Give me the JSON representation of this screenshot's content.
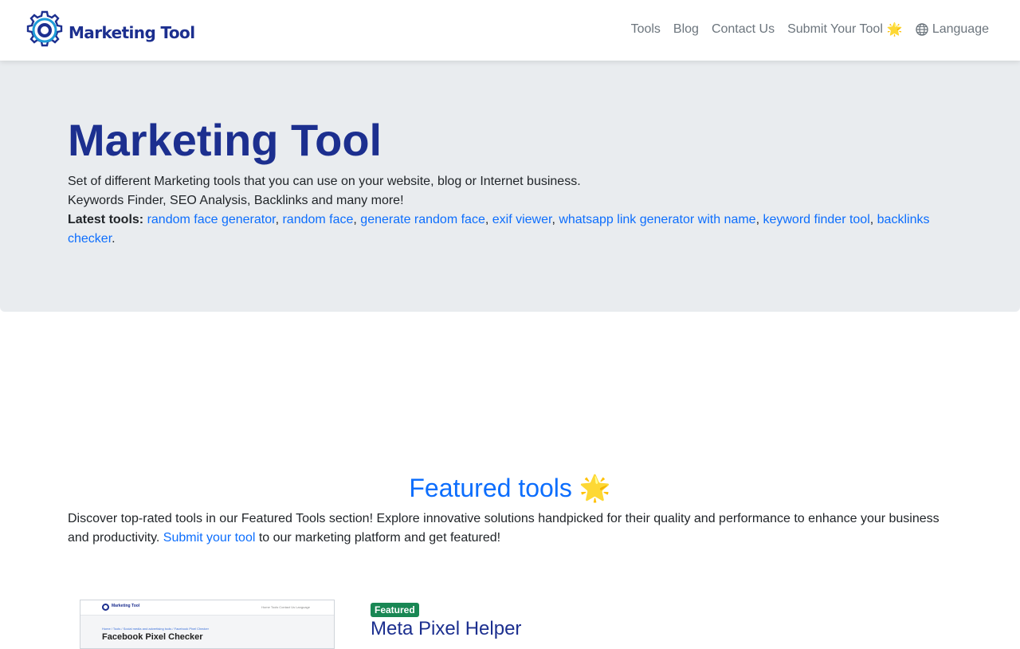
{
  "navbar": {
    "brand": "Marketing Tool",
    "links": [
      {
        "label": "Tools"
      },
      {
        "label": "Blog"
      },
      {
        "label": "Contact Us"
      },
      {
        "label": "Submit Your Tool",
        "icon": "star-icon"
      },
      {
        "label": "Language",
        "icon": "globe-icon"
      }
    ]
  },
  "hero": {
    "title": "Marketing Tool",
    "line1": "Set of different Marketing tools that you can use on your website, blog or Internet business.",
    "line2": "Keywords Finder, SEO Analysis, Backlinks and many more!",
    "latest_label": "Latest tools:",
    "latest_tools": [
      "random face generator",
      "random face",
      "generate random face",
      "exif viewer",
      "whatsapp link generator with name",
      "keyword finder tool",
      "backlinks checker"
    ]
  },
  "featured": {
    "title": "Featured tools",
    "title_icon": "🌟",
    "intro_before": "Discover top-rated tools in our Featured Tools section! Explore innovative solutions handpicked for their quality and performance to enhance your business and productivity.",
    "intro_link": "Submit your tool",
    "intro_after": "to our marketing platform and get featured!",
    "items": [
      {
        "badge": "Featured",
        "name": "Meta Pixel Helper",
        "thumbnail": {
          "brand": "Marketing Tool",
          "nav": "Home  Tools  Contact Us  Language",
          "breadcrumb": "Home / Tools / Social media and advertising tools / Facebook Pixel Checker",
          "title": "Facebook Pixel Checker"
        }
      }
    ]
  },
  "colors": {
    "brand": "#1c2f8f",
    "link": "#0d6efd",
    "hero_bg": "#e9ecef",
    "badge": "#198754"
  }
}
